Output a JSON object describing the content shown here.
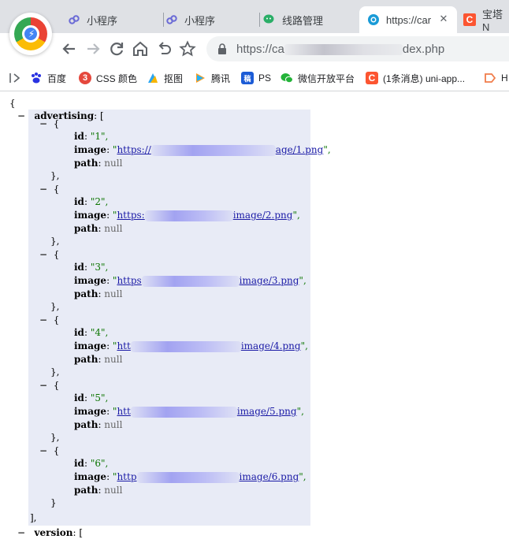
{
  "tabs": [
    {
      "label": "小程序",
      "icon": "mini-program-icon",
      "active": false
    },
    {
      "label": "小程序",
      "icon": "mini-program-icon",
      "active": false
    },
    {
      "label": "线路管理",
      "icon": "wechat-icon",
      "active": false
    },
    {
      "label": "https://car",
      "icon": "globe-icon",
      "active": true
    },
    {
      "label": "宝塔N",
      "icon": "csdn-icon",
      "active": false
    }
  ],
  "address_bar": {
    "url_prefix": "https://ca",
    "url_suffix": "dex.php"
  },
  "bookmarks": [
    {
      "label": "百度",
      "icon": "baidu-icon",
      "color": "#2932e1"
    },
    {
      "label": "CSS 颜色",
      "icon": "css-icon",
      "color": "#e5483d"
    },
    {
      "label": "抠图",
      "icon": "cutout-icon",
      "color": "#2ba6f0"
    },
    {
      "label": "腾讯",
      "icon": "tencent-video-icon",
      "color": "#20b2ff"
    },
    {
      "label": "PS",
      "icon": "ps-icon",
      "color": "#1b5bd6"
    },
    {
      "label": "微信开放平台",
      "icon": "wechat-icon",
      "color": "#24b339"
    },
    {
      "label": "(1条消息) uni-app...",
      "icon": "csdn-icon",
      "color": "#fc5531"
    },
    {
      "label": "H",
      "icon": "bookmark-arrow-icon",
      "color": "#f07c4a"
    }
  ],
  "json": {
    "open_brace": "{",
    "advertising_key": "advertising",
    "advertising_open": ": [",
    "items": [
      {
        "obj_open": "{",
        "id_key": "id",
        "id_value": "\"1\",",
        "image_key": "image",
        "image_prefix": "https://",
        "image_suffix": "age/1.png",
        "path_key": "path",
        "path_value": "null",
        "obj_close": "},"
      },
      {
        "obj_open": "{",
        "id_key": "id",
        "id_value": "\"2\",",
        "image_key": "image",
        "image_prefix": "https:",
        "image_suffix": "image/2.png",
        "path_key": "path",
        "path_value": "null",
        "obj_close": "},"
      },
      {
        "obj_open": "{",
        "id_key": "id",
        "id_value": "\"3\",",
        "image_key": "image",
        "image_prefix": "https",
        "image_suffix": "image/3.png",
        "path_key": "path",
        "path_value": "null",
        "obj_close": "},"
      },
      {
        "obj_open": "{",
        "id_key": "id",
        "id_value": "\"4\",",
        "image_key": "image",
        "image_prefix": "htt",
        "image_suffix": "image/4.png",
        "path_key": "path",
        "path_value": "null",
        "obj_close": "},"
      },
      {
        "obj_open": "{",
        "id_key": "id",
        "id_value": "\"5\",",
        "image_key": "image",
        "image_prefix": "htt",
        "image_suffix": "image/5.png",
        "path_key": "path",
        "path_value": "null",
        "obj_close": "},"
      },
      {
        "obj_open": "{",
        "id_key": "id",
        "id_value": "\"6\",",
        "image_key": "image",
        "image_prefix": "http",
        "image_suffix": "image/6.png",
        "path_key": "path",
        "path_value": "null",
        "obj_close": "}"
      }
    ],
    "advertising_close": "],",
    "version_key": "version",
    "version_open": ": ["
  }
}
